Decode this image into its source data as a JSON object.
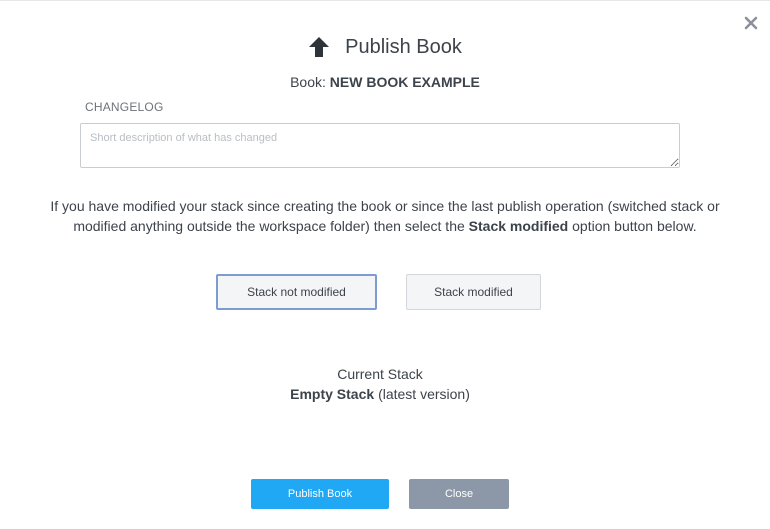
{
  "dialog": {
    "title": "Publish Book",
    "book_label": "Book:",
    "book_name": "NEW BOOK EXAMPLE"
  },
  "changelog": {
    "label": "CHANGELOG",
    "placeholder": "Short description of what has changed",
    "value": ""
  },
  "info": {
    "text_before": "If you have modified your stack since creating the book or since the last publish operation (switched stack or modified anything outside the workspace folder) then select the ",
    "text_bold": "Stack modified",
    "text_after": " option button below."
  },
  "stack_options": {
    "not_modified_label": "Stack not modified",
    "modified_label": "Stack modified",
    "selected": "not_modified"
  },
  "current_stack": {
    "label": "Current Stack",
    "name": "Empty Stack",
    "version_note": "(latest version)"
  },
  "footer": {
    "publish_label": "Publish Book",
    "close_label": "Close"
  },
  "colors": {
    "publish_button": "#20a8f4",
    "close_button": "#8c97a8",
    "selected_border": "#7d9ccf"
  },
  "icons": {
    "title": "upload-arrow-icon",
    "dismiss": "close-icon"
  }
}
